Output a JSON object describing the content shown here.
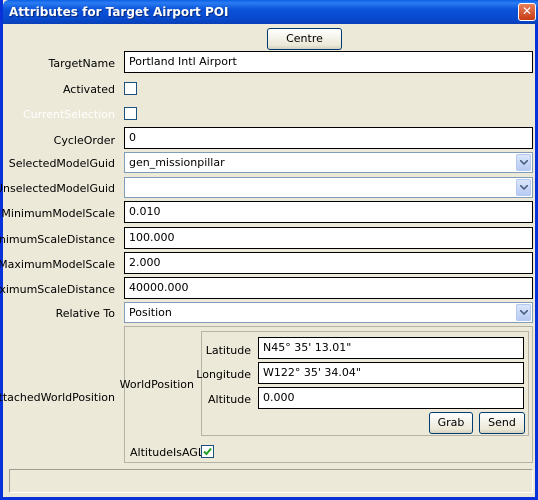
{
  "window": {
    "title": "Attributes for Target Airport POI",
    "close_symbol": "✕"
  },
  "toolbar": {
    "centre_label": "Centre"
  },
  "fields": {
    "target_name": {
      "label": "TargetName",
      "value": "Portland Intl Airport"
    },
    "activated": {
      "label": "Activated",
      "checked": false
    },
    "current_selection": {
      "label": "CurrentSelection",
      "checked": false,
      "disabled": true
    },
    "cycle_order": {
      "label": "CycleOrder",
      "value": "0"
    },
    "selected_model_guid": {
      "label": "SelectedModelGuid",
      "value": "gen_missionpillar"
    },
    "unselected_model_guid": {
      "label": "UnselectedModelGuid",
      "value": ""
    },
    "minimum_model_scale": {
      "label": "MinimumModelScale",
      "value": "0.010"
    },
    "minimum_scale_distance": {
      "label": "MinimumScaleDistance",
      "value": "100.000"
    },
    "maximum_model_scale": {
      "label": "MaximumModelScale",
      "value": "2.000"
    },
    "maximum_scale_distance": {
      "label": "MaximumScaleDistance",
      "value": "40000.000"
    },
    "relative_to": {
      "label": "Relative To",
      "value": "Position"
    }
  },
  "attached_world_position": {
    "label": "AttachedWorldPosition",
    "world_position_label": "WorldPosition",
    "latitude": {
      "label": "Latitude",
      "value": "N45° 35' 13.01\""
    },
    "longitude": {
      "label": "Longitude",
      "value": "W122° 35' 34.04\""
    },
    "altitude": {
      "label": "Altitude",
      "value": "0.000"
    },
    "grab_label": "Grab",
    "send_label": "Send",
    "altitude_is_agl": {
      "label": "AltitudeIsAGL",
      "checked": true
    }
  },
  "status": {
    "text": ""
  },
  "colors": {
    "title_bar": "#0a52d9",
    "window_bg": "#ece9d8",
    "checkmark": "#21a121"
  }
}
